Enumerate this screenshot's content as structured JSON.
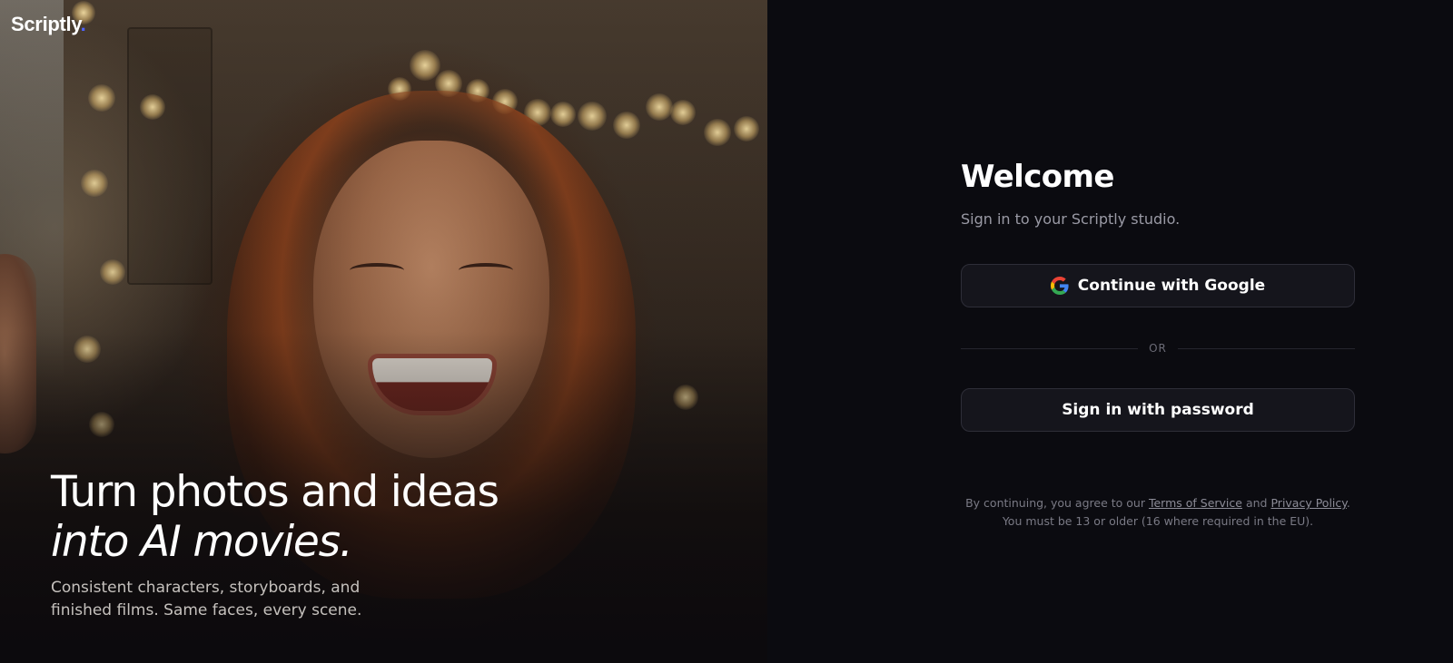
{
  "brand": {
    "name": "Scriptly",
    "dot": ".",
    "accent_color": "#4f63ff"
  },
  "hero": {
    "headline_line1": "Turn photos and ideas",
    "headline_line2": "into AI movies.",
    "subcopy": "Consistent characters, storyboards, and finished films. Same faces, every scene.",
    "image": "smiling-woman-photo"
  },
  "auth": {
    "title": "Welcome",
    "subtitle": "Sign in to your Scriptly studio.",
    "google_button": {
      "label": "Continue with Google",
      "icon": "google-icon"
    },
    "divider_label": "OR",
    "password_button": {
      "label": "Sign in with password"
    },
    "legal": {
      "prefix": "By continuing, you agree to our",
      "terms_link": "Terms of Service",
      "and": "and",
      "privacy_link": "Privacy Policy",
      "period": ".",
      "age_notice": "You must be 13 or older (16 where required in the EU)."
    }
  },
  "colors": {
    "panel_background": "#0b0b10",
    "button_background": "#15151c",
    "button_border": "#2e2e38"
  }
}
